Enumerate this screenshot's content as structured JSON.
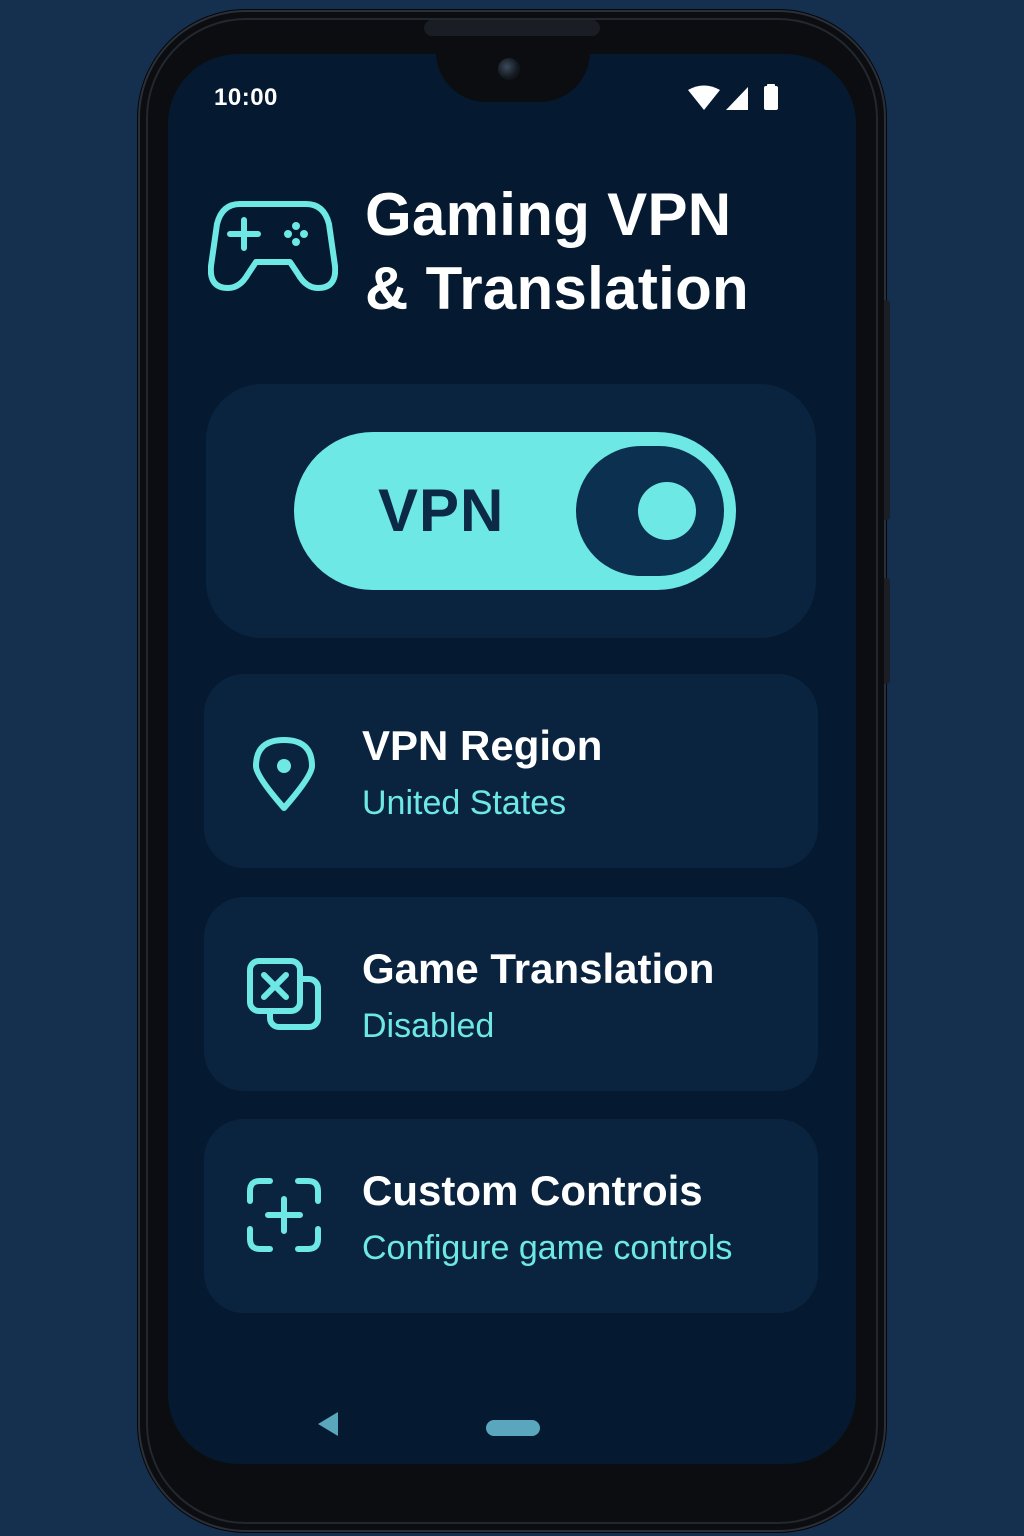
{
  "status_bar": {
    "time": "10:00",
    "icons": [
      "wifi-icon",
      "cellular-signal-icon",
      "battery-icon"
    ]
  },
  "header": {
    "icon": "gamepad-icon",
    "title_line1": "Gaming VPN",
    "title_line2": "& Translation"
  },
  "vpn_toggle": {
    "label": "VPN",
    "state": "on"
  },
  "rows": [
    {
      "icon": "location-pin-icon",
      "title": "VPN Region",
      "subtitle": "United States"
    },
    {
      "icon": "translate-icon",
      "title": "Game Translation",
      "subtitle": "Disabled"
    },
    {
      "icon": "add-control-icon",
      "title": "Custom Controis",
      "subtitle": "Configure game controls"
    }
  ],
  "nav_bar": {
    "icons": [
      "back-icon",
      "home-pill"
    ]
  },
  "colors": {
    "accent": "#6de8e4",
    "screen_bg": "#051a30",
    "card_bg": "#0a2440",
    "page_bg": "#15304f",
    "knob": "#0b3050"
  }
}
